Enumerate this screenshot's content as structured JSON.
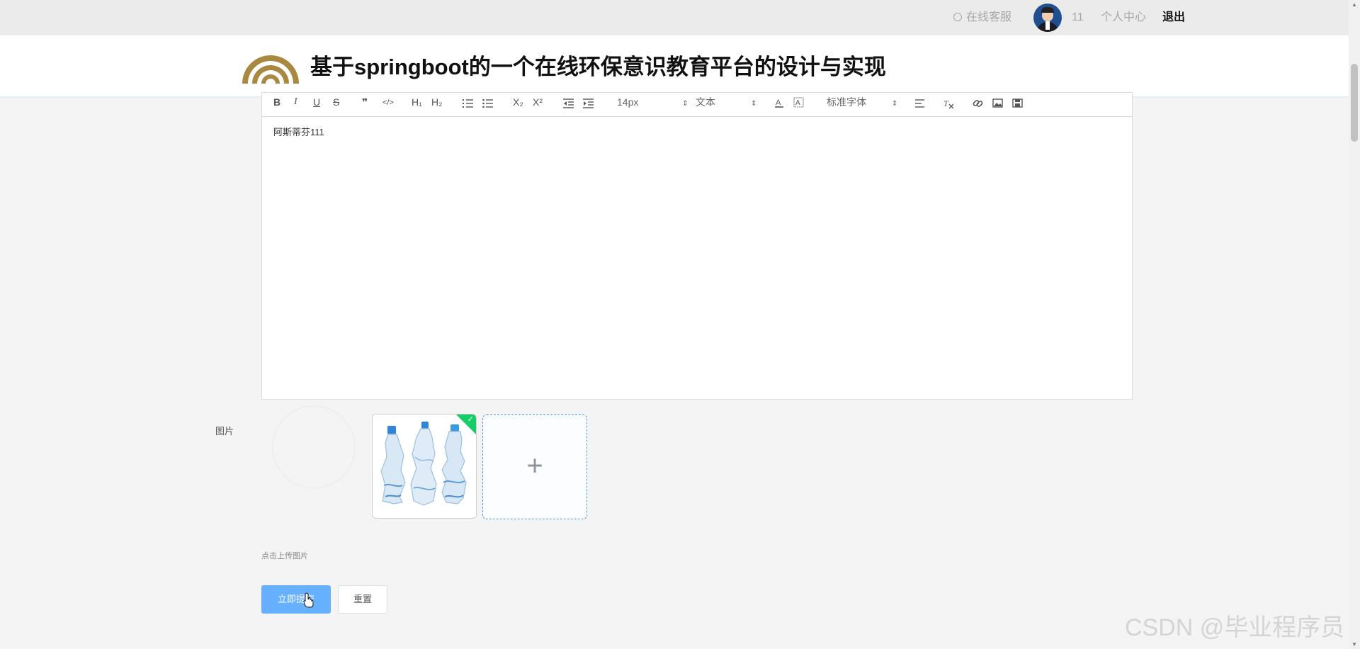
{
  "topbar": {
    "service_label": "在线客服",
    "username": "11",
    "profile_label": "个人中心",
    "logout_label": "退出"
  },
  "header": {
    "title": "基于springboot的一个在线环保意识教育平台的设计与实现"
  },
  "editor": {
    "toolbar": {
      "bold": "B",
      "italic": "I",
      "underline": "U",
      "strike": "S",
      "quote": "❞",
      "code": "</>",
      "h1": "H₁",
      "h2": "H₂",
      "subscript": "X₂",
      "superscript": "X²",
      "font_size": "14px",
      "block_type": "文本",
      "font_family": "标准字体",
      "select_arrow": "⇕"
    },
    "content": "阿斯蒂芬111"
  },
  "image_field": {
    "label": "图片",
    "upload_plus": "+",
    "hint": "点击上传图片",
    "check": "✓"
  },
  "buttons": {
    "submit_label": "立即提交",
    "reset_label": "重置"
  },
  "scrollbar": {
    "up": "▲",
    "down": "▼"
  },
  "watermark": "CSDN @毕业程序员",
  "colors": {
    "primary": "#66b1ff",
    "success": "#13ce66",
    "logo_gold": "#a8893f"
  }
}
